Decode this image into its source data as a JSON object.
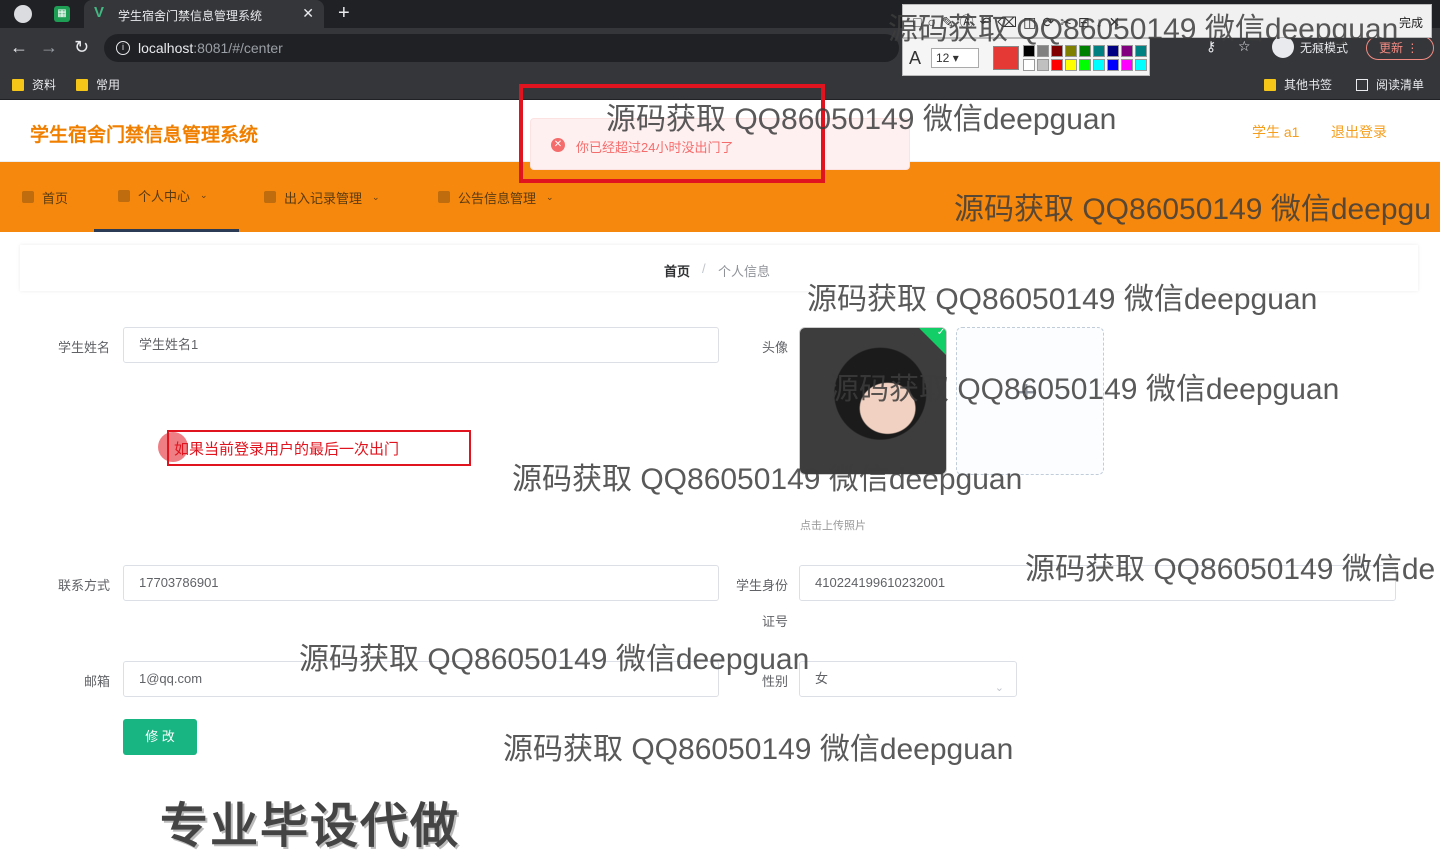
{
  "browser": {
    "tab_title": "学生宿舍门禁信息管理系统",
    "tab_close": "✕",
    "new_tab": "+",
    "url_host": "localhost",
    "url_rest": ":8081/#/center",
    "incognito_label": "无痕模式",
    "update_label": "更新",
    "bookmarks": [
      "资料",
      "常用"
    ],
    "bookmarks_right": [
      "其他书签",
      "阅读清单"
    ]
  },
  "annotation_toolbar": {
    "done_label": "完成",
    "font_size": "12",
    "font_glyph": "A",
    "current_color": "#e53935",
    "palette": [
      "#000000",
      "#808080",
      "#800000",
      "#808000",
      "#008000",
      "#008080",
      "#000080",
      "#800080",
      "#008080",
      "#ffffff",
      "#c0c0c0",
      "#ff0000",
      "#ffff00",
      "#00ff00",
      "#00ffff",
      "#0000ff",
      "#ff00ff",
      "#00ffff"
    ]
  },
  "app": {
    "title": "学生宿舍门禁信息管理系统",
    "user": "学生 a1",
    "logout": "退出登录",
    "accent": "#f5880d"
  },
  "menu": [
    {
      "label": "首页",
      "icon": "home-icon"
    },
    {
      "label": "个人中心",
      "icon": "user-icon"
    },
    {
      "label": "出入记录管理",
      "icon": "grid-icon"
    },
    {
      "label": "公告信息管理",
      "icon": "notice-icon"
    }
  ],
  "breadcrumb": {
    "home": "首页",
    "sep": "/",
    "current": "个人信息"
  },
  "form": {
    "name_label": "学生姓名",
    "name_value": "学生姓名1",
    "avatar_label": "头像",
    "upload_tip": "点击上传照片",
    "phone_label": "联系方式",
    "phone_value": "17703786901",
    "idcard_label_1": "学生身份",
    "idcard_label_2": "证号",
    "idcard_value": "410224199610232001",
    "email_label": "邮箱",
    "email_value": "1@qq.com",
    "gender_label": "性别",
    "gender_value": "女",
    "submit_label": "修 改"
  },
  "toast": {
    "message": "你已经超过24小时没出门了",
    "type": "error"
  },
  "annotation_note": "如果当前登录用户的最后一次出门",
  "watermark_text": "源码获取 QQ86050149 微信deepguan",
  "watermark_partial_1": "源码获取 QQ86050149 微信deepgu",
  "watermark_partial_2": "源码获取 QQ86050149 微信de",
  "watermark_top": "源码获取 QQ86050149 微信deepguan",
  "promo_text": "专业毕设代做"
}
